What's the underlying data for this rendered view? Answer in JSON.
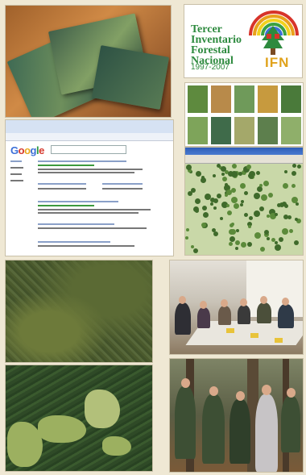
{
  "logo": {
    "line1": "Tercer",
    "line2": "Inventario",
    "line3": "Forestal",
    "line4": "Nacional",
    "years": "1997-2007",
    "acronym": "IFN",
    "colors": {
      "text": "#2d8a3e",
      "acronym": "#e0a21c"
    }
  },
  "google": {
    "logo": [
      "G",
      "o",
      "o",
      "g",
      "l",
      "e"
    ]
  }
}
